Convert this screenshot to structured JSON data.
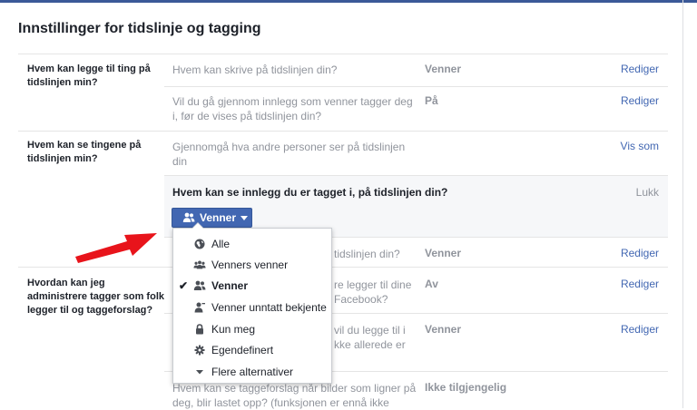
{
  "page": {
    "title": "Innstillinger for tidslinje og tagging"
  },
  "sections": {
    "s1": {
      "label": "Hvem kan legge til ting på tidslinjen min?"
    },
    "s2": {
      "label": "Hvem kan se tingene på tidslinjen min?"
    },
    "s3": {
      "label": "Hvordan kan jeg administrere tagger som folk legger til og taggeforslag?"
    }
  },
  "rows": {
    "r1": {
      "question": "Hvem kan skrive på tidslinjen din?",
      "value": "Venner",
      "action": "Rediger"
    },
    "r2": {
      "question": "Vil du gå gjennom innlegg som venner tagger deg i, før de vises på tidslinjen din?",
      "value": "På",
      "action": "Rediger"
    },
    "r3": {
      "question": "Gjennomgå hva andre personer ser på tidslinjen din",
      "action": "Vis som"
    },
    "r4": {
      "question": "tidslinjen din?",
      "value": "Venner",
      "action": "Rediger"
    },
    "r5": {
      "question_l1": "re legger til dine",
      "question_l2": "Facebook?",
      "value": "Av",
      "action": "Rediger"
    },
    "r6": {
      "question_l1": "vil du legge til i",
      "question_l2": "kke allerede er",
      "value": "Venner",
      "action": "Rediger"
    },
    "r7": {
      "question_l1": "Hvem kan se taggeforslag når bilder som ligner på",
      "question_l2": "deg, blir lastet opp? (funksjonen er ennå ikke",
      "value": "Ikke tilgjengelig"
    }
  },
  "panel": {
    "question": "Hvem kan se innlegg du er tagget i, på tidslinjen din?",
    "close": "Lukk",
    "button_label": "Venner"
  },
  "menu": {
    "items": [
      {
        "label": "Alle",
        "icon": "globe-icon",
        "selected": false
      },
      {
        "label": "Venners venner",
        "icon": "friends-of-friends-icon",
        "selected": false
      },
      {
        "label": "Venner",
        "icon": "friends-icon",
        "selected": true
      },
      {
        "label": "Venner unntatt bekjente",
        "icon": "friends-except-icon",
        "selected": false
      },
      {
        "label": "Kun meg",
        "icon": "lock-icon",
        "selected": false
      },
      {
        "label": "Egendefinert",
        "icon": "gear-icon",
        "selected": false
      },
      {
        "label": "Flere alternativer",
        "icon": "triangle-down-icon",
        "selected": false
      }
    ]
  },
  "colors": {
    "accent": "#4267b2",
    "annotation_arrow": "#e8141b"
  }
}
